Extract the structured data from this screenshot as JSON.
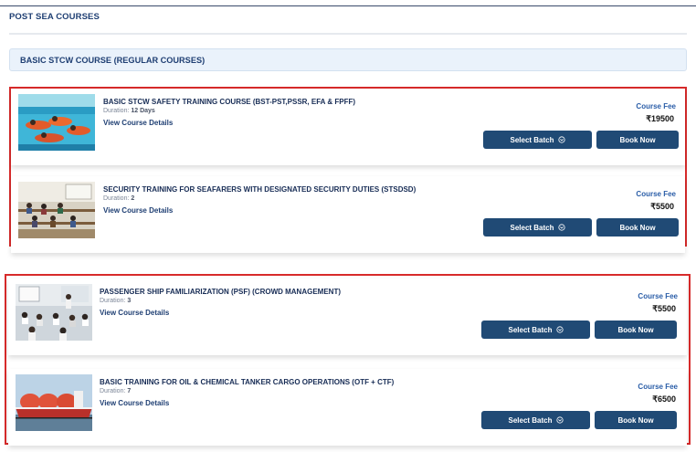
{
  "page": {
    "title": "POST SEA COURSES"
  },
  "section": {
    "title": "BASIC STCW COURSE (REGULAR COURSES)"
  },
  "labels": {
    "duration_prefix": "Duration:",
    "view_details": "View Course Details",
    "course_fee": "Course Fee",
    "select_batch": "Select Batch",
    "book_now": "Book Now"
  },
  "courses": [
    {
      "title": "BASIC STCW SAFETY TRAINING COURSE (BST-PST,PSSR, EFA & FPFF)",
      "duration": "12 Days",
      "fee": "₹19500",
      "thumbnail": "pool-survival-training-photo"
    },
    {
      "title": "SECURITY TRAINING FOR SEAFARERS WITH DESIGNATED SECURITY DUTIES (STSDSD)",
      "duration": "2",
      "fee": "₹5500",
      "thumbnail": "classroom-photo"
    },
    {
      "title": "PASSENGER SHIP FAMILIARIZATION (PSF) (CROWD MANAGEMENT)",
      "duration": "3",
      "fee": "₹5500",
      "thumbnail": "lecture-hall-photo"
    },
    {
      "title": "BASIC TRAINING FOR OIL & CHEMICAL TANKER CARGO OPERATIONS (OTF + CTF)",
      "duration": "7",
      "fee": "₹6500",
      "thumbnail": "gas-tanker-ship-photo"
    }
  ],
  "colors": {
    "highlight_border": "#d72a2a",
    "button": "#204a75",
    "section_header_bg": "#eaf2fb",
    "fee_label": "#2b5ea8"
  }
}
